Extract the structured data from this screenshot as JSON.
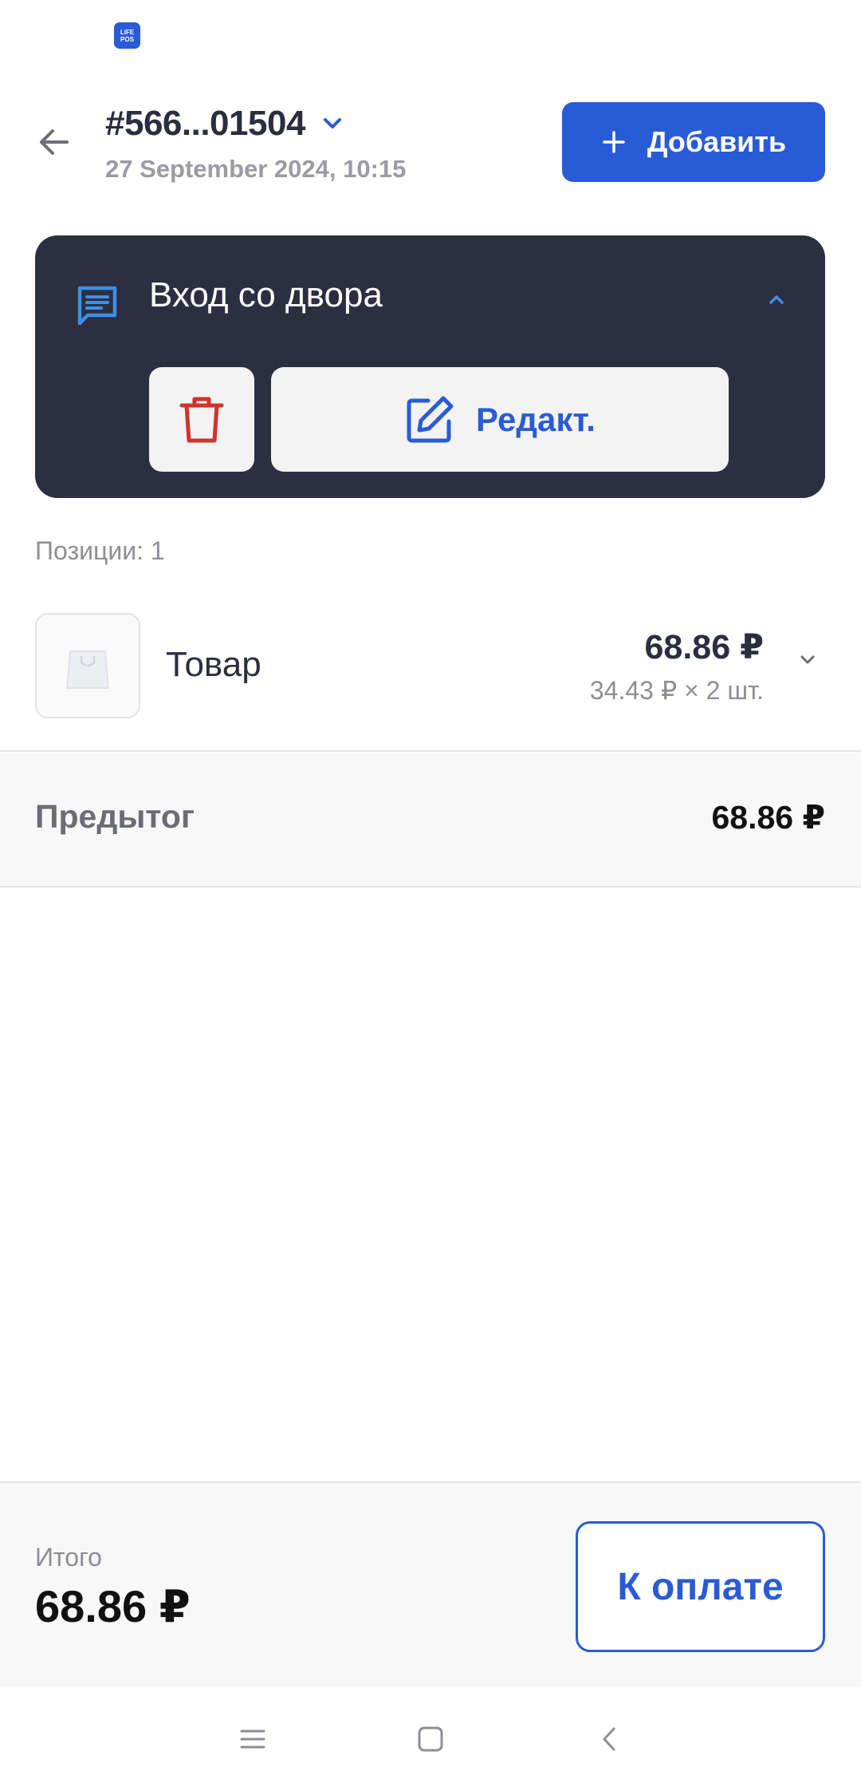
{
  "app": {
    "logo_text": "LIFE POS"
  },
  "header": {
    "order_id": "#566...01504",
    "date": "27 September 2024, 10:15",
    "add_label": "Добавить"
  },
  "note": {
    "text": "Вход со двора",
    "edit_label": "Редакт."
  },
  "positions": {
    "label": "Позиции: 1"
  },
  "items": [
    {
      "name": "Товар",
      "total": "68.86 ₽",
      "unit_line": "34.43 ₽ × 2 шт."
    }
  ],
  "subtotal": {
    "label": "Предытог",
    "value": "68.86 ₽"
  },
  "footer": {
    "total_label": "Итого",
    "total_value": "68.86 ₽",
    "pay_label": "К оплате"
  },
  "colors": {
    "accent": "#2a5bd7",
    "card_dark": "#2c2f40",
    "delete_red": "#d0332b"
  },
  "icons": [
    "app-logo",
    "arrow-left-icon",
    "chevron-down-icon",
    "plus-icon",
    "comment-icon",
    "chevron-up-icon",
    "trash-icon",
    "edit-icon",
    "bag-icon",
    "menu-icon",
    "home-square-icon",
    "back-chevron-icon"
  ]
}
